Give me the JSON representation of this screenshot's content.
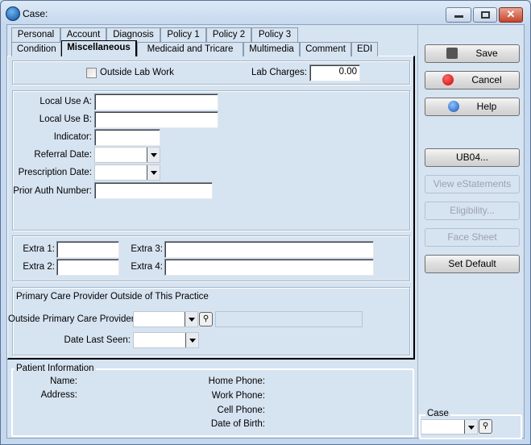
{
  "window": {
    "title": "Case:",
    "icon": "app-logo-icon"
  },
  "tabs_row1": [
    "Personal",
    "Account",
    "Diagnosis",
    "Policy 1",
    "Policy 2",
    "Policy 3"
  ],
  "tabs_row2": [
    "Condition",
    "Miscellaneous",
    "Medicaid and Tricare",
    "Multimedia",
    "Comment",
    "EDI"
  ],
  "active_tab": "Miscellaneous",
  "lab": {
    "outside_label": "Outside Lab Work",
    "outside_checked": false,
    "charges_label": "Lab Charges:",
    "charges_value": "0.00"
  },
  "local": {
    "a_label": "Local Use A:",
    "a_value": "",
    "b_label": "Local Use B:",
    "b_value": "",
    "indicator_label": "Indicator:",
    "indicator_value": "",
    "referral_label": "Referral Date:",
    "prescription_label": "Prescription Date:",
    "prior_auth_label": "Prior Auth Number:",
    "prior_auth_value": ""
  },
  "extra": {
    "e1": "Extra 1:",
    "e2": "Extra 2:",
    "e3": "Extra 3:",
    "e4": "Extra 4:"
  },
  "pcp": {
    "heading": "Primary Care Provider Outside of This Practice",
    "provider_label": "Outside Primary Care Provider:",
    "date_label": "Date Last Seen:"
  },
  "patient": {
    "heading": "Patient Information",
    "name": "Name:",
    "address": "Address:",
    "home": "Home Phone:",
    "work": "Work Phone:",
    "cell": "Cell Phone:",
    "dob": "Date of Birth:"
  },
  "buttons": {
    "save": "Save",
    "cancel": "Cancel",
    "help": "Help",
    "ub04": "UB04...",
    "view_estatements": "View eStatements",
    "eligibility": "Eligibility...",
    "face_sheet": "Face Sheet",
    "set_default": "Set Default"
  },
  "case_group": {
    "label": "Case",
    "value": ""
  },
  "colors": {
    "background": "#d6e3f1",
    "disabled_text": "#9aa3ad"
  }
}
